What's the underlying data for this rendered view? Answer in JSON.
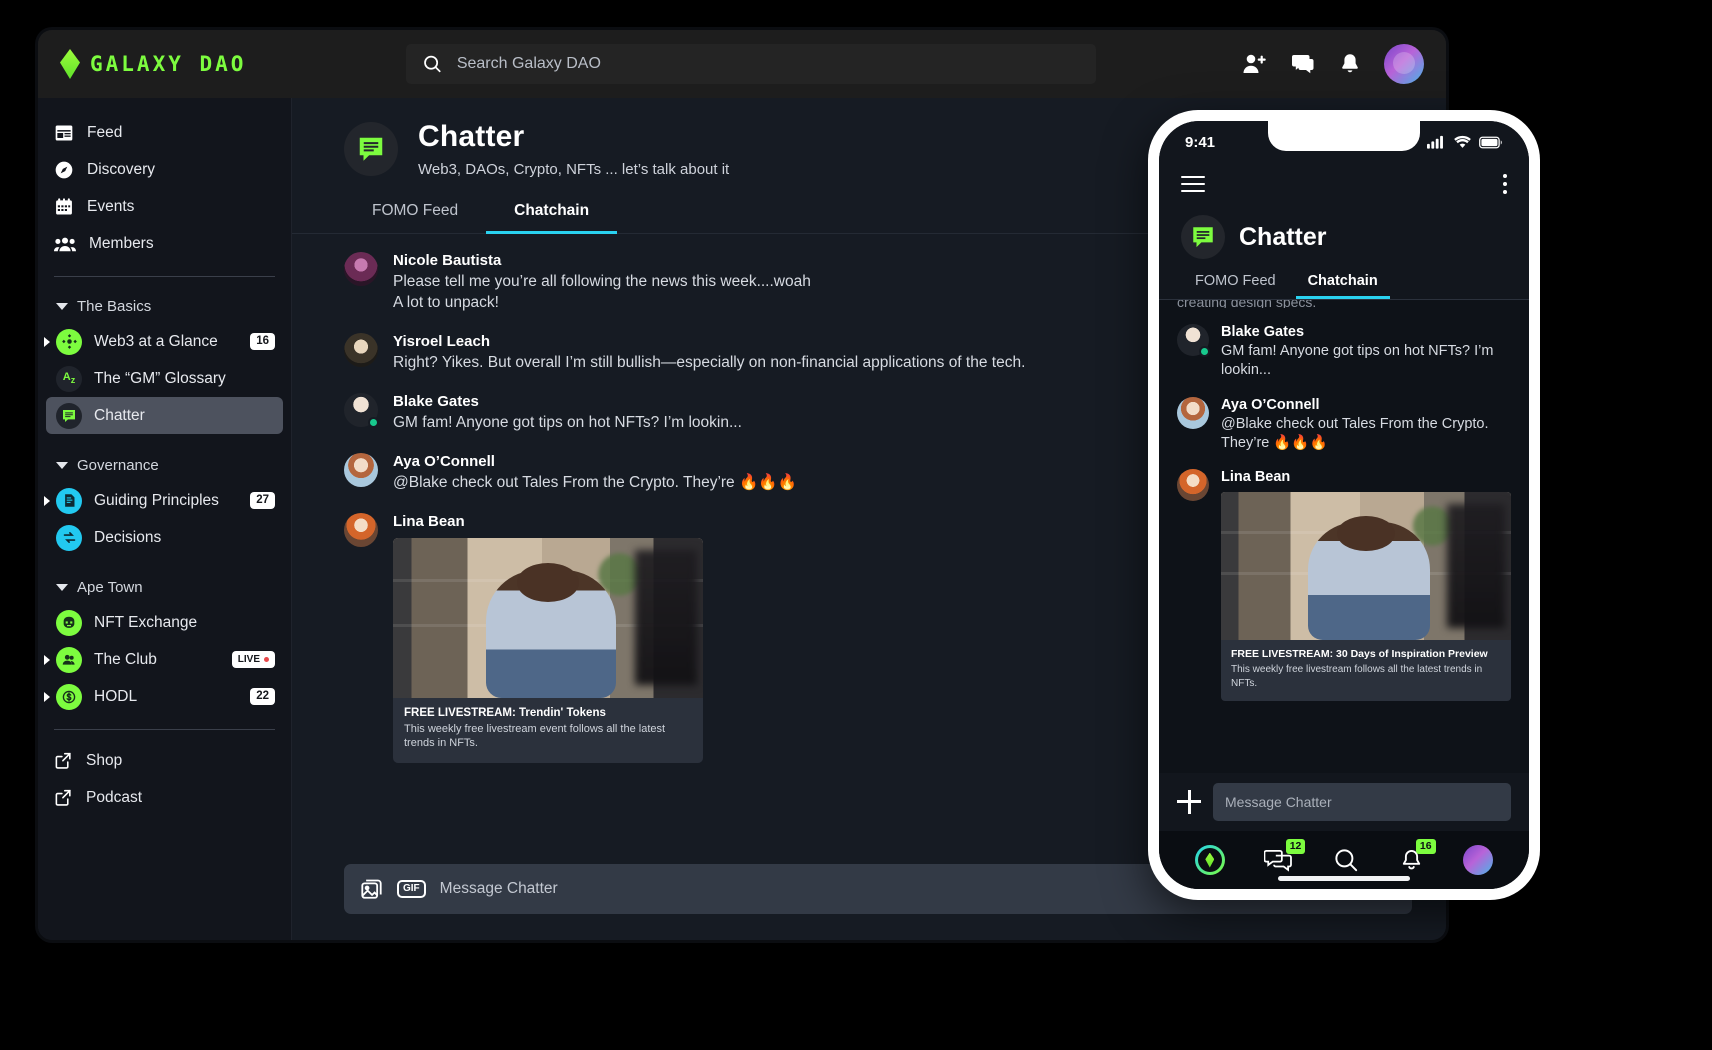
{
  "brand": {
    "name": "GALAXY DAO",
    "logo_icon": "galaxy-diamond-icon",
    "accent_green": "#7dfc3f",
    "accent_cyan": "#22d3ee"
  },
  "search": {
    "placeholder": "Search Galaxy DAO",
    "value": "",
    "icon": "search-icon"
  },
  "topbar_icons": [
    {
      "name": "add-person-icon"
    },
    {
      "name": "messages-icon"
    },
    {
      "name": "bell-icon"
    },
    {
      "name": "user-avatar"
    }
  ],
  "sidebar": {
    "primary": [
      {
        "label": "Feed",
        "icon": "feed-icon"
      },
      {
        "label": "Discovery",
        "icon": "compass-icon"
      },
      {
        "label": "Events",
        "icon": "calendar-icon"
      },
      {
        "label": "Members",
        "icon": "members-icon"
      }
    ],
    "groups": [
      {
        "label": "The Basics",
        "items": [
          {
            "label": "Web3 at a Glance",
            "icon": "web3-icon",
            "icon_color": "green",
            "badge": "16",
            "expandable": true,
            "active": false
          },
          {
            "label": "The “GM” Glossary",
            "icon": "az-glossary-icon",
            "icon_color": "green",
            "badge": "",
            "expandable": false,
            "active": false
          },
          {
            "label": "Chatter",
            "icon": "chat-bubble-icon",
            "icon_color": "green",
            "badge": "",
            "expandable": false,
            "active": true
          }
        ]
      },
      {
        "label": "Governance",
        "items": [
          {
            "label": "Guiding Principles",
            "icon": "document-edit-icon",
            "icon_color": "cyan",
            "badge": "27",
            "expandable": true,
            "active": false
          },
          {
            "label": "Decisions",
            "icon": "swap-arrows-icon",
            "icon_color": "cyan",
            "badge": "",
            "expandable": false,
            "active": false
          }
        ]
      },
      {
        "label": "Ape Town",
        "items": [
          {
            "label": "NFT Exchange",
            "icon": "alien-icon",
            "icon_color": "green",
            "badge": "",
            "expandable": false,
            "active": false
          },
          {
            "label": "The Club",
            "icon": "people-icon",
            "icon_color": "green",
            "badge": "LIVE",
            "badge_live": true,
            "expandable": true,
            "active": false
          },
          {
            "label": "HODL",
            "icon": "dollar-coin-icon",
            "icon_color": "green",
            "badge": "22",
            "expandable": true,
            "active": false
          }
        ]
      }
    ],
    "footer": [
      {
        "label": "Shop",
        "icon": "external-link-icon"
      },
      {
        "label": "Podcast",
        "icon": "external-link-icon"
      }
    ]
  },
  "channel": {
    "icon": "chat-bubble-icon",
    "title": "Chatter",
    "subtitle": "Web3, DAOs, Crypto, NFTs ... let’s talk about it",
    "add_button_icon": "plus-icon",
    "tabs": [
      {
        "label": "FOMO Feed",
        "active": false
      },
      {
        "label": "Chatchain",
        "active": true
      }
    ]
  },
  "messages": [
    {
      "author": "Nicole Bautista",
      "avatar": "avatar-nicole",
      "online": false,
      "lines": [
        "Please tell me you’re all following the news this week....woah",
        "A lot to unpack!"
      ]
    },
    {
      "author": "Yisroel Leach",
      "avatar": "avatar-yisroel",
      "online": false,
      "lines": [
        "Right? Yikes. But overall I’m still bullish—especially on non-financial applications of the tech."
      ]
    },
    {
      "author": "Blake Gates",
      "avatar": "avatar-blake",
      "online": true,
      "lines": [
        "GM fam! Anyone got tips on hot NFTs? I’m lookin..."
      ]
    },
    {
      "author": "Aya O’Connell",
      "avatar": "avatar-aya",
      "online": false,
      "lines": [
        "@Blake check out Tales From the Crypto. They’re 🔥🔥🔥"
      ]
    },
    {
      "author": "Lina Bean",
      "avatar": "avatar-lina",
      "online": false,
      "lines": [],
      "card": {
        "title": "FREE LIVESTREAM: Trendin' Tokens",
        "description": "This weekly free livestream event follows all the latest trends in NFTs.",
        "image_alt": "man-sitting-on-couch-talking"
      }
    }
  ],
  "composer": {
    "placeholder": "Message Chatter",
    "value": "",
    "image_icon": "image-upload-icon",
    "gif_label": "GIF",
    "emoji_icon": "emoji-smiley-icon"
  },
  "phone": {
    "status": {
      "time": "9:41",
      "signal_icon": "cellular-signal-icon",
      "wifi_icon": "wifi-icon",
      "battery_icon": "battery-icon"
    },
    "menu_icon": "hamburger-menu-icon",
    "overflow_icon": "kebab-menu-icon",
    "channel": {
      "icon": "chat-bubble-icon",
      "title": "Chatter"
    },
    "tabs": [
      {
        "label": "FOMO Feed",
        "active": false
      },
      {
        "label": "Chatchain",
        "active": true
      }
    ],
    "clipped_message": "creating design specs.",
    "messages": [
      {
        "author": "Blake Gates",
        "avatar": "avatar-blake",
        "online": true,
        "lines": [
          "GM fam! Anyone got tips on hot NFTs? I’m lookin..."
        ]
      },
      {
        "author": "Aya O’Connell",
        "avatar": "avatar-aya",
        "online": false,
        "lines": [
          "@Blake check out Tales From the Crypto. They’re 🔥🔥🔥"
        ]
      },
      {
        "author": "Lina Bean",
        "avatar": "avatar-lina",
        "online": false,
        "lines": [],
        "card": {
          "title": "FREE LIVESTREAM: 30 Days of Inspiration Preview",
          "description": "This weekly free livestream follows all the latest trends in NFTs.",
          "image_alt": "man-sitting-on-couch-talking"
        }
      }
    ],
    "composer": {
      "plus_icon": "plus-icon",
      "placeholder": "Message Chatter",
      "value": ""
    },
    "bottom_nav": [
      {
        "name": "home-logo-icon",
        "badge": ""
      },
      {
        "name": "messages-icon",
        "badge": "12"
      },
      {
        "name": "search-icon",
        "badge": ""
      },
      {
        "name": "bell-icon",
        "badge": "16"
      },
      {
        "name": "user-avatar",
        "badge": ""
      }
    ]
  }
}
